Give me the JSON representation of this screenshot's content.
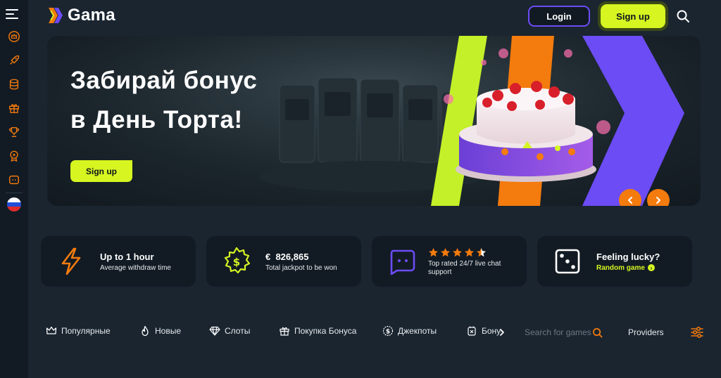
{
  "app": {
    "name": "Gama"
  },
  "colors": {
    "accent_lime": "#d6f521",
    "accent_orange": "#f47b0d",
    "accent_purple": "#6c4cf5",
    "background": "#1a2530",
    "panel": "#121b24"
  },
  "header": {
    "login_label": "Login",
    "signup_label": "Sign up"
  },
  "sidebar": {
    "items": [
      {
        "icon": "crown-circle-icon"
      },
      {
        "icon": "rocket-icon"
      },
      {
        "icon": "coins-stack-icon"
      },
      {
        "icon": "gift-icon"
      },
      {
        "icon": "trophy-icon"
      },
      {
        "icon": "medal-icon"
      },
      {
        "icon": "chat-bubble-icon"
      }
    ],
    "language": "ru-flag-icon"
  },
  "banner": {
    "title_line1": "Забирай бонус",
    "title_line2": "в День Торта!",
    "button_label": "Sign up"
  },
  "features": [
    {
      "icon": "lightning-icon",
      "title": "Up to 1 hour",
      "subtitle": "Average withdraw time"
    },
    {
      "icon": "dollar-badge-icon",
      "title": "€  826,865",
      "subtitle": "Total jackpot to be won"
    },
    {
      "icon": "chat-icon",
      "rating": 4.5,
      "subtitle_line1": "Top rated 24/7 live chat",
      "subtitle_line2": "support"
    },
    {
      "icon": "dice-icon",
      "title": "Feeling lucky?",
      "link": "Random game"
    }
  ],
  "categories": {
    "items": [
      {
        "icon": "crown-icon",
        "label": "Популярные"
      },
      {
        "icon": "fire-icon",
        "label": "Новые"
      },
      {
        "icon": "diamond-icon",
        "label": "Слоты"
      },
      {
        "icon": "gift-icon",
        "label": "Покупка Бонуса"
      },
      {
        "icon": "dollar-coin-icon",
        "label": "Джекпоты"
      },
      {
        "icon": "bonus-icon",
        "label": "Бонусы"
      }
    ],
    "search_placeholder": "Search for games",
    "providers_label": "Providers"
  }
}
